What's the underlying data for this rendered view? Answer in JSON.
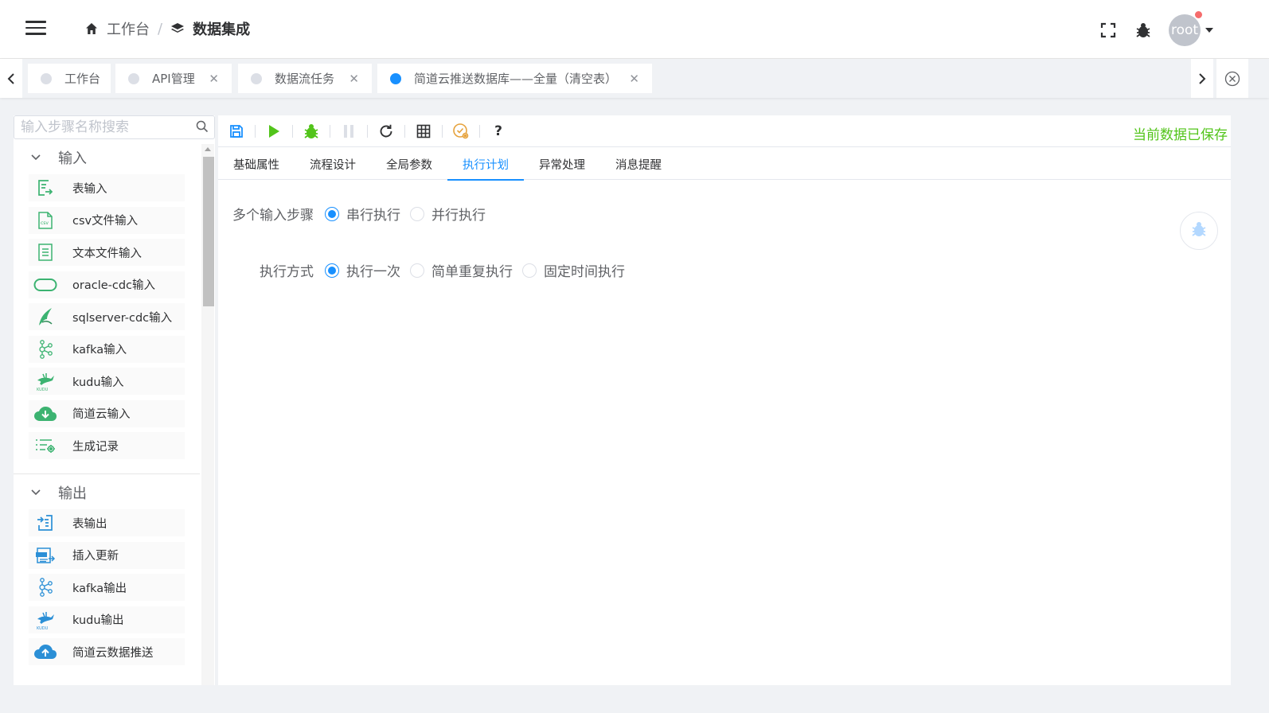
{
  "header": {
    "breadcrumb_home": "工作台",
    "breadcrumb_current": "数据集成",
    "avatar_text": "root"
  },
  "tabs": [
    {
      "label": "工作台",
      "active": false,
      "closable": false
    },
    {
      "label": "API管理",
      "active": false,
      "closable": true
    },
    {
      "label": "数据流任务",
      "active": false,
      "closable": true
    },
    {
      "label": "简道云推送数据库——全量（清空表）",
      "active": true,
      "closable": true
    }
  ],
  "sidebar": {
    "search_placeholder": "输入步骤名称搜索",
    "groups": [
      {
        "title": "输入",
        "items": [
          {
            "label": "表输入",
            "icon": "table-input-icon"
          },
          {
            "label": "csv文件输入",
            "icon": "csv-file-icon"
          },
          {
            "label": "文本文件输入",
            "icon": "text-file-icon"
          },
          {
            "label": "oracle-cdc输入",
            "icon": "oracle-icon"
          },
          {
            "label": "sqlserver-cdc输入",
            "icon": "sqlserver-icon"
          },
          {
            "label": "kafka输入",
            "icon": "kafka-icon"
          },
          {
            "label": "kudu输入",
            "icon": "kudu-icon"
          },
          {
            "label": "简道云输入",
            "icon": "cloud-download-icon"
          },
          {
            "label": "生成记录",
            "icon": "generate-records-icon"
          }
        ]
      },
      {
        "title": "输出",
        "items": [
          {
            "label": "表输出",
            "icon": "table-output-icon"
          },
          {
            "label": "插入更新",
            "icon": "insert-update-icon"
          },
          {
            "label": "kafka输出",
            "icon": "kafka-icon"
          },
          {
            "label": "kudu输出",
            "icon": "kudu-icon"
          },
          {
            "label": "简道云数据推送",
            "icon": "cloud-upload-icon"
          }
        ]
      }
    ]
  },
  "toolbar": {
    "saved_status": "当前数据已保存",
    "help_label": "?"
  },
  "subtabs": [
    "基础属性",
    "流程设计",
    "全局参数",
    "执行计划",
    "异常处理",
    "消息提醒"
  ],
  "active_subtab": "执行计划",
  "form": {
    "multi_input": {
      "label": "多个输入步骤",
      "options": [
        "串行执行",
        "并行执行"
      ],
      "selected": "串行执行"
    },
    "exec_mode": {
      "label": "执行方式",
      "options": [
        "执行一次",
        "简单重复执行",
        "固定时间执行"
      ],
      "selected": "执行一次"
    }
  },
  "colors": {
    "primary": "#1890ff",
    "success": "#52c41a",
    "icon_green": "#3cb371",
    "warning": "#e6a23c"
  }
}
